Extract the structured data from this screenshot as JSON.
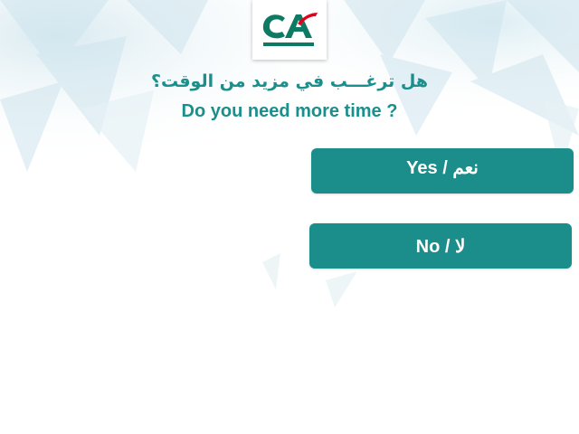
{
  "colors": {
    "accent": "#1b8e8b",
    "question_text": "#1a8f8c",
    "logo_green": "#0f7a63",
    "logo_red": "#e2001a"
  },
  "logo": {
    "icon": "credit-agricole-logo-icon"
  },
  "prompt": {
    "question_ar": "هل ترغـــب في مزيد من الوقت؟",
    "question_en": "Do you need more time ?"
  },
  "buttons": {
    "yes_label": "Yes / نعم",
    "no_label": "No /  لا"
  }
}
